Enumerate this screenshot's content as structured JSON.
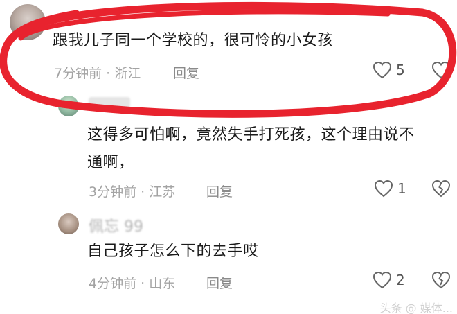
{
  "comments": [
    {
      "text": "跟我儿子同一个学校的，很可怜的小女孩",
      "meta": "7分钟前 · 浙江",
      "reply_label": "回复",
      "like_count": "5"
    },
    {
      "text_line1": "这得多可怕啊，竟然失手打死孩，这个理由说不",
      "text_line2": "通啊，",
      "meta": "3分钟前 · 江苏",
      "reply_label": "回复",
      "like_count": "1"
    },
    {
      "username": "佩忘 99",
      "text": "自己孩子怎么下的去手哎",
      "meta": "4分钟前 · 山东",
      "reply_label": "回复",
      "like_count": "2"
    }
  ],
  "watermark": "头条 @ 媒体...",
  "colors": {
    "annotation": "#e8232e",
    "meta": "#a3a3a3",
    "text": "#1a1a1a"
  },
  "icons": [
    "heart-icon",
    "broken-heart-icon"
  ]
}
